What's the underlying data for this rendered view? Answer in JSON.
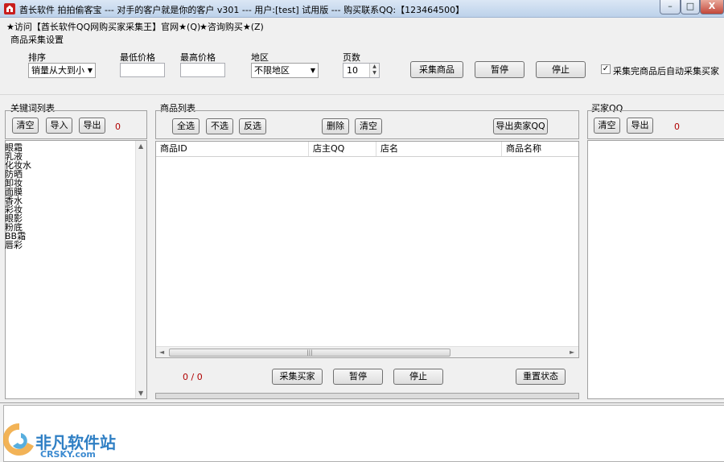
{
  "window": {
    "title": "酋长软件 拍拍偷客宝 --- 对手的客户就是你的客户 v301 --- 用户:[test] 试用版 --- 购买联系QQ:【123464500】",
    "minimize": "–",
    "maximize": "□",
    "close": "X"
  },
  "menu": {
    "items": [
      "★访问【酋长软件QQ网购买家采集王】官网★(Q)",
      "★咨询购买★(Z)"
    ]
  },
  "settings": {
    "group_title": "商品采集设置",
    "sort_label": "排序",
    "sort_value": "销量从大到小",
    "min_price_label": "最低价格",
    "min_price_value": "",
    "max_price_label": "最高价格",
    "max_price_value": "",
    "region_label": "地区",
    "region_value": "不限地区",
    "pages_label": "页数",
    "pages_value": "10",
    "collect_button": "采集商品",
    "pause_button": "暂停",
    "stop_button": "停止",
    "auto_collect_checked": true,
    "auto_collect_label": "采集完商品后自动采集买家"
  },
  "keywords": {
    "title": "关键词列表",
    "clear_button": "清空",
    "import_button": "导入",
    "export_button": "导出",
    "count": "0",
    "items": [
      "眼霜",
      "乳液",
      "化妆水",
      "防晒",
      "卸妆",
      "面膜",
      "香水",
      "彩妆",
      "眼影",
      "粉底",
      "BB霜",
      "唇彩"
    ]
  },
  "products": {
    "title": "商品列表",
    "select_all_button": "全选",
    "select_none_button": "不选",
    "invert_button": "反选",
    "delete_button": "删除",
    "clear_button": "清空",
    "export_seller_button": "导出卖家QQ",
    "columns": [
      "商品ID",
      "店主QQ",
      "店名",
      "商品名称"
    ],
    "progress": "0 / 0",
    "collect_buyers_button": "采集买家",
    "pause_button": "暂停",
    "stop_button": "停止",
    "reset_button": "重置状态"
  },
  "buyers": {
    "title": "买家QQ",
    "clear_button": "清空",
    "export_button": "导出",
    "count": "0"
  },
  "watermark": {
    "text": "非凡软件站",
    "subtext": "CRSKY.com"
  }
}
